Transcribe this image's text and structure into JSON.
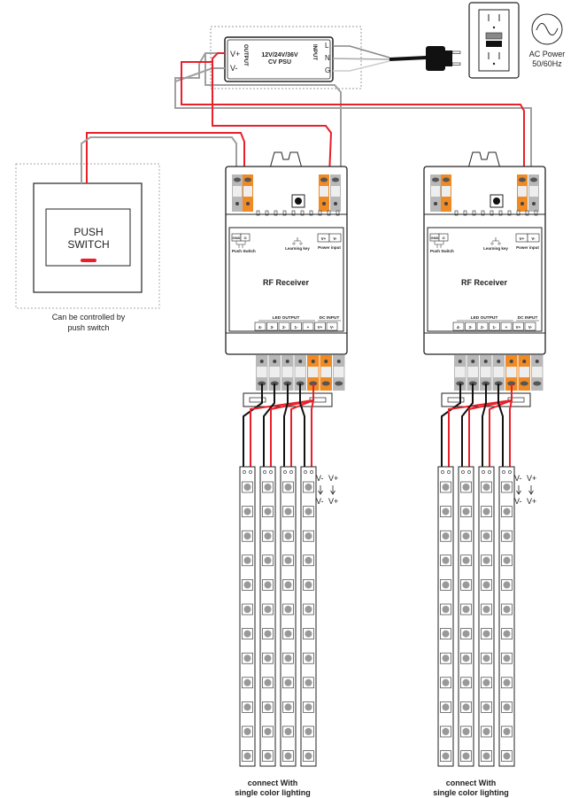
{
  "psu": {
    "line1": "12V/24V/36V",
    "line2": "CV PSU",
    "output_label": "OUTPUT",
    "input_label": "INPUT",
    "vplus": "V+",
    "vminus": "V-",
    "l": "L",
    "n": "N",
    "g": "G"
  },
  "ac": {
    "line1": "AC Power",
    "line2": "50/60Hz",
    "icon": "sine-wave-icon"
  },
  "push_switch": {
    "line1": "PUSH",
    "line2": "SWITCH",
    "caption1": "Can be controlled by",
    "caption2": "push switch"
  },
  "receiver": {
    "title": "RF Receiver",
    "gnd": "GND",
    "ps_o": "O",
    "push_label": "Push Switch",
    "learning_key": "Learning key",
    "power_input": "Power input",
    "pvplus": "V+",
    "pvminus": "V-",
    "led_output": "LED OUTPUT",
    "dc_input": "DC INPUT",
    "terminals": [
      "4-",
      "3-",
      "2-",
      "1-",
      "+",
      "V+",
      "V-"
    ]
  },
  "strip_labels": {
    "top_minus": "V-",
    "top_plus": "V+",
    "bot_minus": "V-",
    "bot_plus": "V+"
  },
  "caption": {
    "line1": "connect With",
    "line2": "single color lighting"
  },
  "colors": {
    "red": "#e8202a",
    "gray": "#a0a0a0",
    "orange": "#f08a24",
    "terminal_gray": "#b8b8b8"
  }
}
